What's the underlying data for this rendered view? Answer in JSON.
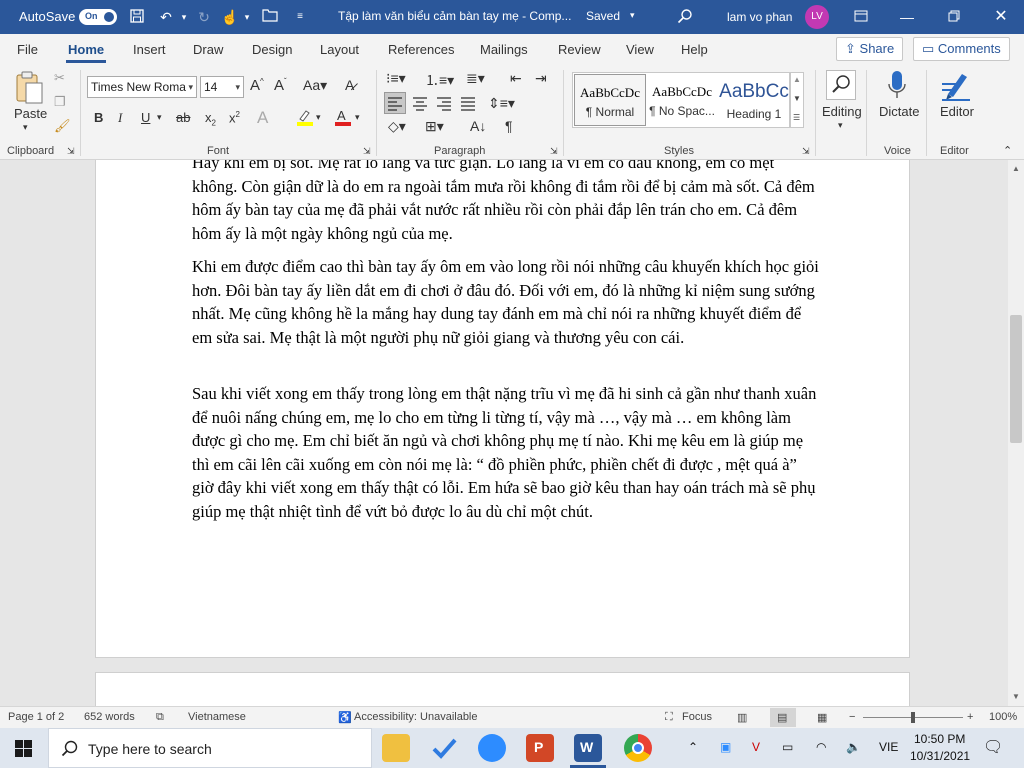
{
  "titlebar": {
    "autosave_label": "AutoSave",
    "autosave_state": "On",
    "doc_title": "Tập làm văn biểu cảm bàn tay mẹ  -  Comp...",
    "saved_status": "Saved",
    "user_name": "lam vo phan",
    "user_initials": "LV"
  },
  "tabs": [
    "File",
    "Home",
    "Insert",
    "Draw",
    "Design",
    "Layout",
    "References",
    "Mailings",
    "Review",
    "View",
    "Help"
  ],
  "share_label": "Share",
  "comments_label": "Comments",
  "ribbon": {
    "paste_label": "Paste",
    "font_name": "Times New Roma",
    "font_size": "14",
    "groups": {
      "clipboard": "Clipboard",
      "font": "Font",
      "paragraph": "Paragraph",
      "styles": "Styles",
      "voice": "Voice",
      "editor": "Editor"
    },
    "styles": [
      {
        "sample": "AaBbCcDc",
        "name": "¶ Normal"
      },
      {
        "sample": "AaBbCcDc",
        "name": "¶ No Spac..."
      },
      {
        "sample": "AaBbCc",
        "name": "Heading 1"
      }
    ],
    "editing_label": "Editing",
    "dictate_label": "Dictate",
    "editor_label": "Editor"
  },
  "document": {
    "paragraphs": [
      "Hay khi em bị sốt. Mẹ rất lo lắng và tức giận. Lo lắng là vì em có đau không, em có mệt không. Còn giận dữ là do em ra ngoài tắm mưa rồi không đi tắm rồi để bị cảm mà sốt. Cả đêm hôm ấy bàn tay của mẹ đã phải vắt nước rất nhiều rồi còn phải đắp lên trán cho em. Cả đêm hôm ấy là một ngày không ngủ của mẹ.",
      "Khi em được điểm cao thì bàn tay ấy ôm em vào long rồi nói những câu khuyến khích học giỏi hơn.  Đôi bàn tay ấy liền dắt em đi chơi ở đâu đó. Đối với em,  đó là những kỉ niệm sung sướng nhất. Mẹ cũng không hề la mắng hay dung tay đánh em mà chỉ nói ra những khuyết điểm để em sửa sai. Mẹ thật là một người phụ nữ giỏi giang và thương yêu con cái.",
      "Sau khi viết xong em thấy trong lòng em thật nặng trĩu vì mẹ đã hi sinh cả gần như thanh xuân để nuôi nấng chúng em, mẹ lo cho em từng li từng tí, vậy mà …, vậy mà … em không làm được gì cho mẹ. Em chỉ biết ăn ngủ và chơi không phụ mẹ tí nào. Khi mẹ kêu em là giúp mẹ thì em cãi lên cãi xuống em còn nói mẹ là: “ đồ phiền phức, phiền chết đi được , mệt quá à” giờ đây khi viết xong em thấy thật có lỗi. Em hứa sẽ bao giờ kêu than  hay oán trách mà sẽ phụ giúp mẹ thật nhiệt tình để vứt bỏ được lo âu dù chỉ một chút."
    ]
  },
  "status": {
    "page": "Page 1 of 2",
    "words": "652 words",
    "language": "Vietnamese",
    "accessibility": "Accessibility: Unavailable",
    "focus": "Focus",
    "zoom": "100%",
    "zoom_level": 1.0
  },
  "taskbar": {
    "search_placeholder": "Type here to search",
    "lang": "VIE",
    "time": "10:50 PM",
    "date": "10/31/2021"
  },
  "colors": {
    "brand": "#2b579a",
    "avatar": "#c239b3"
  }
}
